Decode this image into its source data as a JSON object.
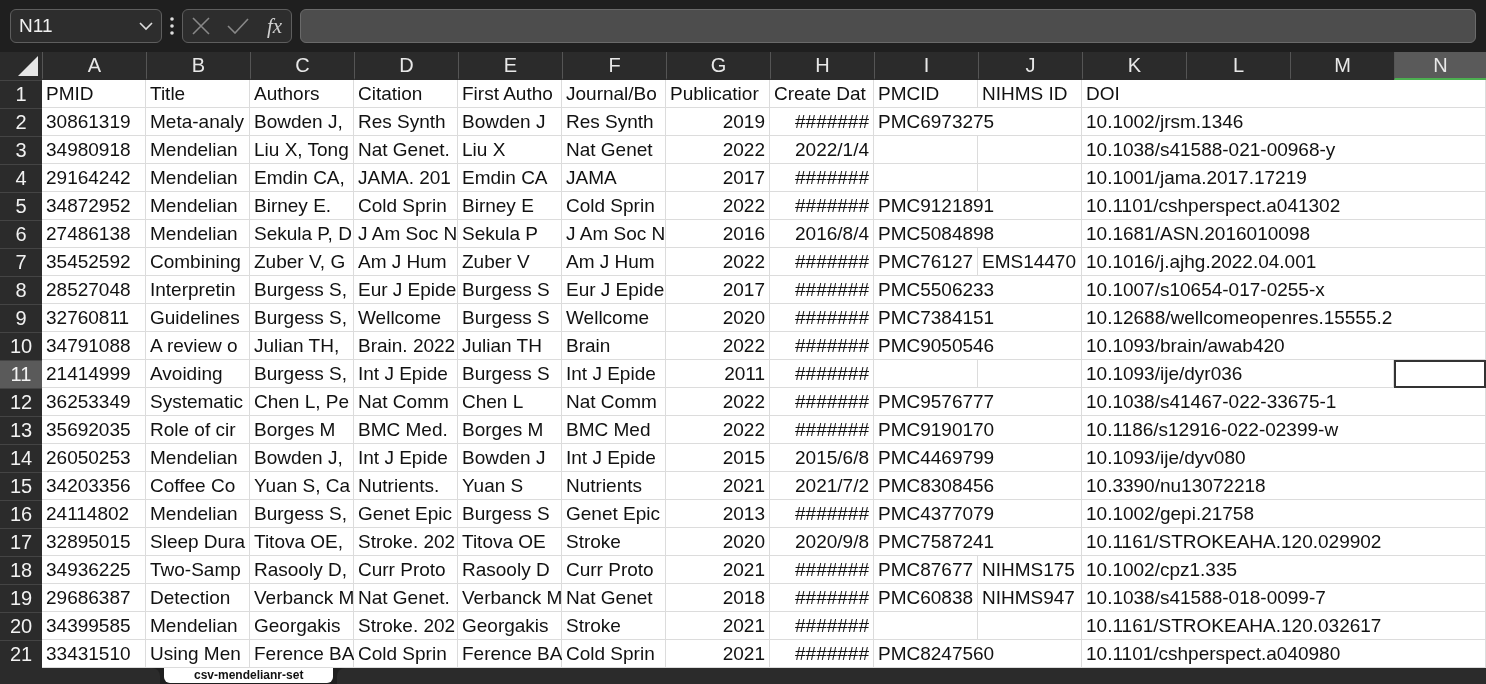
{
  "formula_bar": {
    "name_box": "N11",
    "function_label": "fx"
  },
  "columns": [
    {
      "letter": "A",
      "kind": "text",
      "selected": false
    },
    {
      "letter": "B",
      "kind": "text",
      "selected": false
    },
    {
      "letter": "C",
      "kind": "text",
      "selected": false
    },
    {
      "letter": "D",
      "kind": "text",
      "selected": false
    },
    {
      "letter": "E",
      "kind": "text",
      "selected": false
    },
    {
      "letter": "F",
      "kind": "text",
      "selected": false
    },
    {
      "letter": "G",
      "kind": "number",
      "selected": false
    },
    {
      "letter": "H",
      "kind": "number",
      "selected": false
    },
    {
      "letter": "I",
      "kind": "text",
      "selected": false
    },
    {
      "letter": "J",
      "kind": "text",
      "selected": false
    },
    {
      "letter": "K",
      "kind": "text",
      "selected": false
    },
    {
      "letter": "L",
      "selected": false
    },
    {
      "letter": "M",
      "selected": false
    },
    {
      "letter": "N",
      "selected": true
    }
  ],
  "rows": [
    {
      "number": "1",
      "kind": "header",
      "selected": false,
      "cells": [
        "PMID",
        "Title",
        "Authors",
        "Citation",
        "First Autho",
        "Journal/Bo",
        "Publicatior",
        "Create Dat",
        "PMCID",
        "NIHMS ID",
        "DOI"
      ]
    },
    {
      "number": "2",
      "kind": "data",
      "selected": false,
      "cells": [
        "30861319",
        "Meta-analy",
        "Bowden J,",
        "Res Synth",
        "Bowden J",
        "Res Synth",
        "2019",
        "#######",
        "PMC6973275",
        null,
        "10.1002/jrsm.1346"
      ]
    },
    {
      "number": "3",
      "kind": "data",
      "selected": false,
      "cells": [
        "34980918",
        "Mendelian",
        "Liu X, Tong",
        "Nat Genet.",
        "Liu X",
        "Nat Genet",
        "2022",
        "2022/1/4",
        null,
        null,
        "10.1038/s41588-021-00968-y"
      ]
    },
    {
      "number": "4",
      "kind": "data",
      "selected": false,
      "cells": [
        "29164242",
        "Mendelian",
        "Emdin CA,",
        "JAMA. 201",
        "Emdin CA",
        "JAMA",
        "2017",
        "#######",
        null,
        null,
        "10.1001/jama.2017.17219"
      ]
    },
    {
      "number": "5",
      "kind": "data",
      "selected": false,
      "cells": [
        "34872952",
        "Mendelian",
        "Birney E.",
        "Cold Sprin",
        "Birney E",
        "Cold Sprin",
        "2022",
        "#######",
        "PMC9121891",
        null,
        "10.1101/cshperspect.a041302"
      ]
    },
    {
      "number": "6",
      "kind": "data",
      "selected": false,
      "cells": [
        "27486138",
        "Mendelian",
        "Sekula P, D",
        "J Am Soc N",
        "Sekula P",
        "J Am Soc N",
        "2016",
        "2016/8/4",
        "PMC5084898",
        null,
        "10.1681/ASN.2016010098"
      ]
    },
    {
      "number": "7",
      "kind": "data",
      "selected": false,
      "cells": [
        "35452592",
        "Combining",
        "Zuber V, G",
        "Am J Hum",
        "Zuber V",
        "Am J Hum",
        "2022",
        "#######",
        "PMC76127",
        "EMS14470",
        "10.1016/j.ajhg.2022.04.001"
      ]
    },
    {
      "number": "8",
      "kind": "data",
      "selected": false,
      "cells": [
        "28527048",
        "Interpretin",
        "Burgess S,",
        "Eur J Epide",
        "Burgess S",
        "Eur J Epide",
        "2017",
        "#######",
        "PMC5506233",
        null,
        "10.1007/s10654-017-0255-x"
      ]
    },
    {
      "number": "9",
      "kind": "data",
      "selected": false,
      "cells": [
        "32760811",
        "Guidelines",
        "Burgess S,",
        "Wellcome",
        "Burgess S",
        "Wellcome",
        "2020",
        "#######",
        "PMC7384151",
        null,
        "10.12688/wellcomeopenres.15555.2"
      ]
    },
    {
      "number": "10",
      "kind": "data",
      "selected": false,
      "cells": [
        "34791088",
        "A review o",
        "Julian TH,",
        "Brain. 2022",
        "Julian TH",
        "Brain",
        "2022",
        "#######",
        "PMC9050546",
        null,
        "10.1093/brain/awab420"
      ]
    },
    {
      "number": "11",
      "kind": "data",
      "selected": true,
      "cells": [
        "21414999",
        "Avoiding",
        "Burgess S,",
        "Int J Epide",
        "Burgess S",
        "Int J Epide",
        "2011",
        "#######",
        null,
        null,
        "10.1093/ije/dyr036"
      ]
    },
    {
      "number": "12",
      "kind": "data",
      "selected": false,
      "cells": [
        "36253349",
        "Systematic",
        "Chen L, Pe",
        "Nat Comm",
        "Chen L",
        "Nat Comm",
        "2022",
        "#######",
        "PMC9576777",
        null,
        "10.1038/s41467-022-33675-1"
      ]
    },
    {
      "number": "13",
      "kind": "data",
      "selected": false,
      "cells": [
        "35692035",
        "Role of cir",
        "Borges M",
        "BMC Med.",
        "Borges M",
        "BMC Med",
        "2022",
        "#######",
        "PMC9190170",
        null,
        "10.1186/s12916-022-02399-w"
      ]
    },
    {
      "number": "14",
      "kind": "data",
      "selected": false,
      "cells": [
        "26050253",
        "Mendelian",
        "Bowden J,",
        "Int J Epide",
        "Bowden J",
        "Int J Epide",
        "2015",
        "2015/6/8",
        "PMC4469799",
        null,
        "10.1093/ije/dyv080"
      ]
    },
    {
      "number": "15",
      "kind": "data",
      "selected": false,
      "cells": [
        "34203356",
        "Coffee Co",
        "Yuan S, Ca",
        "Nutrients.",
        "Yuan S",
        "Nutrients",
        "2021",
        "2021/7/2",
        "PMC8308456",
        null,
        "10.3390/nu13072218"
      ]
    },
    {
      "number": "16",
      "kind": "data",
      "selected": false,
      "cells": [
        "24114802",
        "Mendelian",
        "Burgess S,",
        "Genet Epic",
        "Burgess S",
        "Genet Epic",
        "2013",
        "#######",
        "PMC4377079",
        null,
        "10.1002/gepi.21758"
      ]
    },
    {
      "number": "17",
      "kind": "data",
      "selected": false,
      "cells": [
        "32895015",
        "Sleep Dura",
        "Titova OE,",
        "Stroke. 202",
        "Titova OE",
        "Stroke",
        "2020",
        "2020/9/8",
        "PMC7587241",
        null,
        "10.1161/STROKEAHA.120.029902"
      ]
    },
    {
      "number": "18",
      "kind": "data",
      "selected": false,
      "cells": [
        "34936225",
        "Two-Samp",
        "Rasooly D,",
        "Curr Proto",
        "Rasooly D",
        "Curr Proto",
        "2021",
        "#######",
        "PMC87677",
        "NIHMS175",
        "10.1002/cpz1.335"
      ]
    },
    {
      "number": "19",
      "kind": "data",
      "selected": false,
      "cells": [
        "29686387",
        "Detection",
        "Verbanck M",
        "Nat Genet.",
        "Verbanck M",
        "Nat Genet",
        "2018",
        "#######",
        "PMC60838",
        "NIHMS947",
        "10.1038/s41588-018-0099-7"
      ]
    },
    {
      "number": "20",
      "kind": "data",
      "selected": false,
      "cells": [
        "34399585",
        "Mendelian",
        "Georgakis",
        "Stroke. 202",
        "Georgakis",
        "Stroke",
        "2021",
        "#######",
        null,
        null,
        "10.1161/STROKEAHA.120.032617"
      ]
    },
    {
      "number": "21",
      "kind": "data",
      "selected": false,
      "cells": [
        "33431510",
        "Using Men",
        "Ference BA",
        "Cold Sprin",
        "Ference BA",
        "Cold Sprin",
        "2021",
        "#######",
        "PMC8247560",
        null,
        "10.1101/cshperspect.a040980"
      ]
    }
  ],
  "sheet_tabs": [
    {
      "label": "csv-mendelianr-set",
      "selected": true
    }
  ]
}
